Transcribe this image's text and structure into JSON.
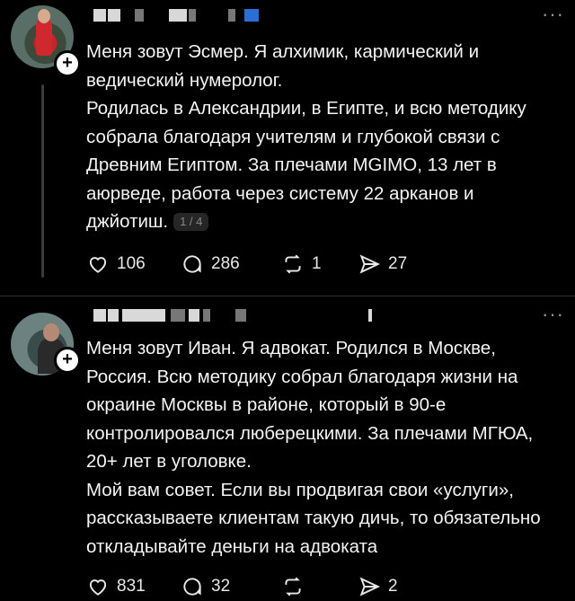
{
  "posts": [
    {
      "text_lines": [
        "Меня зовут Эсмер. Я алхимик, кармический и",
        "ведический нумеролог.",
        "Родилась в Александрии, в Египте, и всю методику",
        "собрала благодаря учителям и глубокой связи с",
        "Древним Египтом. За плечами MGIMO, 13 лет в",
        "аюрведе, работа через систему 22 арканов и",
        "джйотиш."
      ],
      "pager": "1 / 4",
      "likes": "106",
      "comments": "286",
      "reposts": "1",
      "shares": "27"
    },
    {
      "text_lines": [
        "Меня зовут Иван. Я адвокат. Родился в Москве,",
        "Россия. Всю методику собрал благодаря жизни на",
        "окраине Москвы в районе, который в 90-е",
        "контролировался люберецкими. За плечами МГЮА,",
        "20+ лет в уголовке.",
        "Мой вам совет. Если вы продвигая свои «услуги»,",
        "рассказываете клиентам такую дичь, то обязательно",
        "откладывайте деньги на адвоката"
      ],
      "likes": "831",
      "comments": "32",
      "reposts": "",
      "shares": "2"
    }
  ],
  "more_label": "···",
  "plus_label": "+",
  "colors": {
    "background": "#000000",
    "text": "#f4f4f4",
    "muted": "#9a9a9a",
    "redaction_blue": "#2b6fd6"
  },
  "icons": [
    "heart-icon",
    "comment-icon",
    "repost-icon",
    "share-icon",
    "more-icon",
    "follow-plus-icon"
  ]
}
